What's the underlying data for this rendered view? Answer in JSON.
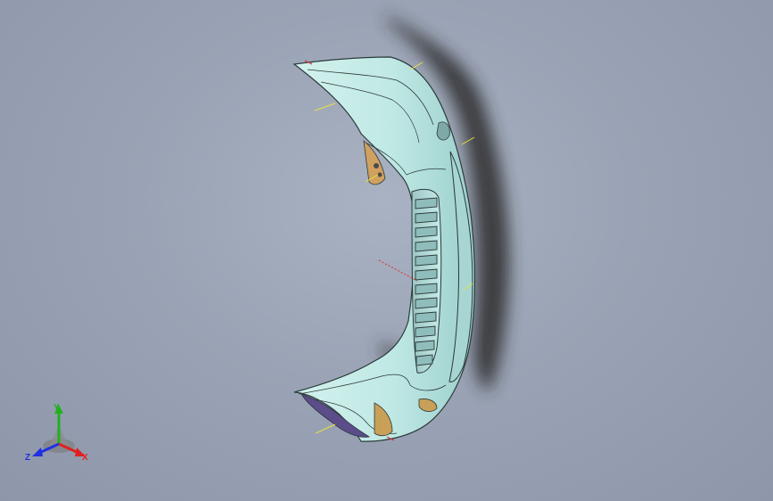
{
  "viewport": {
    "background_top": "#a9b2c2",
    "background_bottom": "#8e97aa"
  },
  "model": {
    "name_icon": "bumper-part-icon",
    "body_color": "#bfe8e4",
    "edge_color": "#2b3a3a",
    "shadow_color": "#2a2a2a"
  },
  "triad": {
    "x_label": "X",
    "y_label": "Y",
    "z_label": "Z",
    "x_color": "#e02020",
    "y_color": "#20b020",
    "z_color": "#2030e0"
  }
}
